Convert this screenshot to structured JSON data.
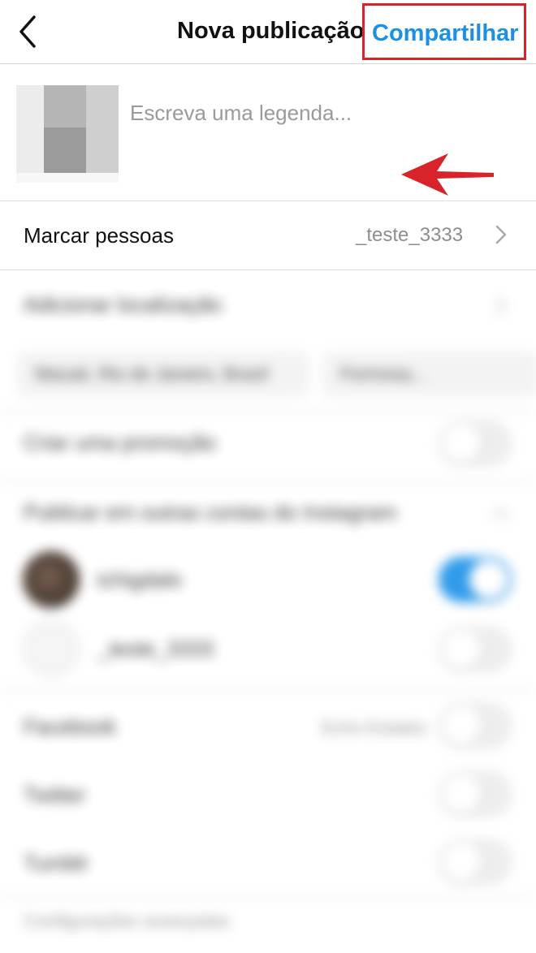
{
  "header": {
    "title": "Nova publicação",
    "share_label": "Compartilhar",
    "back_icon": "chevron-left-icon"
  },
  "caption": {
    "placeholder": "Escreva uma legenda...",
    "value": ""
  },
  "tag_people": {
    "label": "Marcar pessoas",
    "value": "_teste_3333"
  },
  "blurred": {
    "add_location_label": "Adicionar localização",
    "location_chips": [
      "Macaé, Rio de Janeiro, Brazil",
      "Formosa..."
    ],
    "promotion_label": "Criar uma promoção",
    "other_accounts_label": "Publicar em outras contas do Instagram",
    "accounts": [
      {
        "name": "tchigdalo",
        "enabled": true
      },
      {
        "name": "_teste_3333",
        "enabled": false
      }
    ],
    "facebook_label": "Facebook",
    "facebook_sub": "Echo Estates",
    "twitter_label": "Twitter",
    "tumblr_label": "Tumblr",
    "advanced_label": "Configurações avançadas"
  },
  "colors": {
    "accent": "#1a91e8",
    "highlight_border": "#d8232a",
    "annotation_arrow": "#d8232a"
  }
}
